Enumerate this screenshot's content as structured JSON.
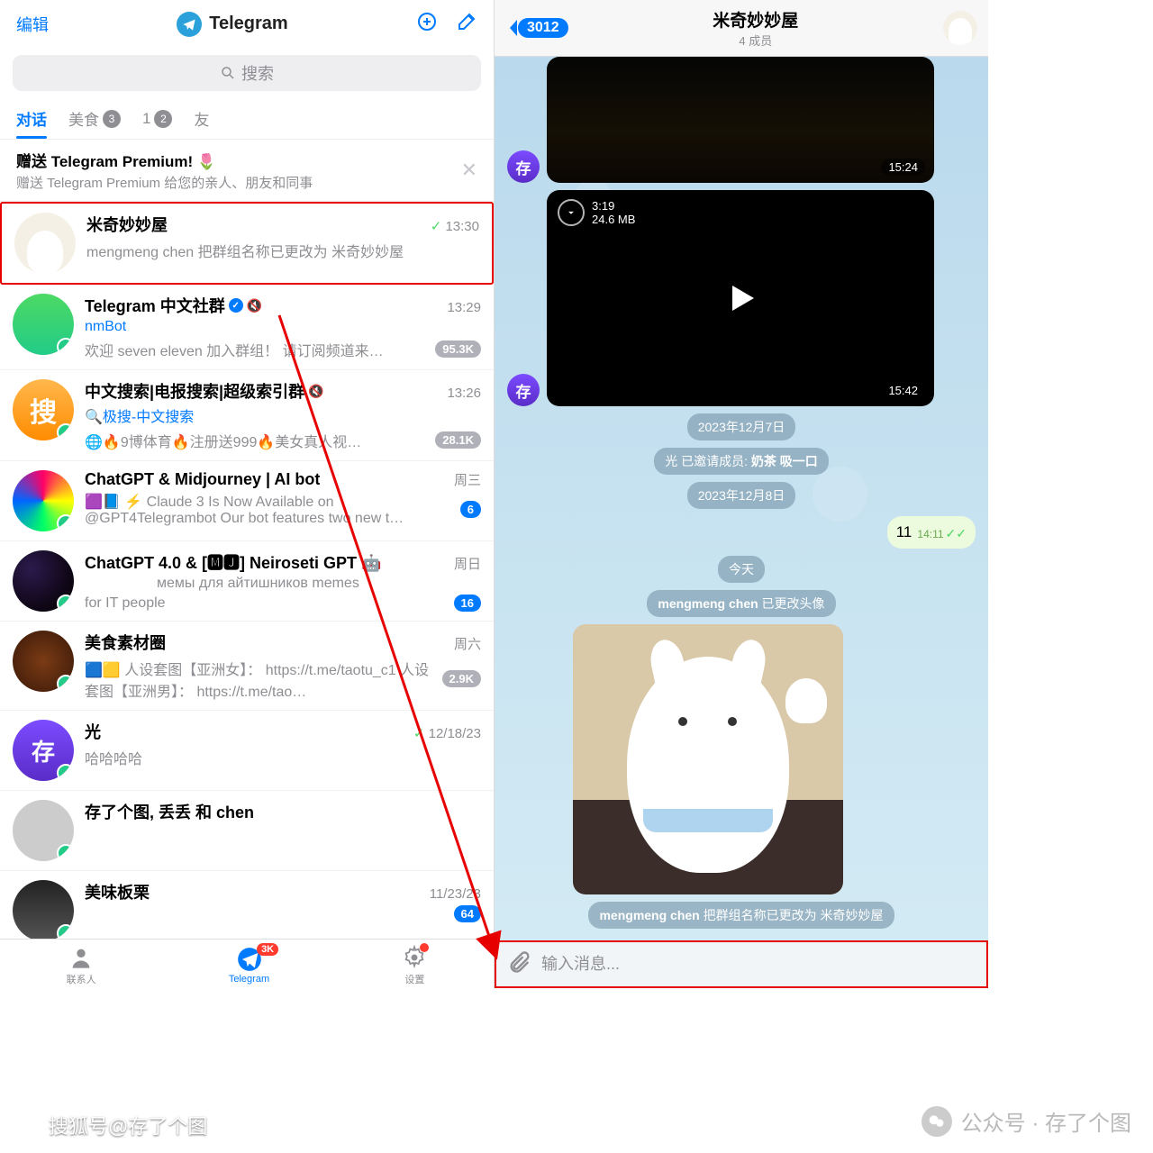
{
  "left": {
    "edit": "编辑",
    "title": "Telegram",
    "search_placeholder": "搜索",
    "tabs": [
      {
        "label": "对话",
        "active": true
      },
      {
        "label": "美食",
        "badge": "3"
      },
      {
        "label": "1",
        "badge": "2"
      },
      {
        "label": "友"
      }
    ],
    "promo": {
      "title": "赠送 Telegram Premium! 🌷",
      "subtitle": "赠送 Telegram Premium 给您的亲人、朋友和同事"
    },
    "chats": [
      {
        "name": "米奇妙妙屋",
        "time": "13:30",
        "check": true,
        "msg": "mengmeng chen 把群组名称已更改为 米奇妙妙屋",
        "sub": "",
        "hl": true,
        "avatar": "cat"
      },
      {
        "name": "Telegram 中文社群",
        "verified": true,
        "muted": true,
        "time": "13:29",
        "sub": "nmBot",
        "msg": "欢迎 seven eleven 加入群组！ 请订阅频道来…",
        "badge": "95.3K",
        "avatar": "green"
      },
      {
        "name": "中文搜索|电报搜索|超级索引群",
        "muted": true,
        "time": "13:26",
        "sub": "🔍极搜-中文搜索",
        "msg": "🌐🔥9博体育🔥注册送999🔥美女真人视…",
        "badge": "28.1K",
        "avatar": "orange",
        "avatarText": "搜"
      },
      {
        "name": "ChatGPT & Midjourney | AI bot",
        "time": "周三",
        "msg": "🟪📘 ⚡ Claude 3 Is Now Available on @GPT4Telegrambot Our bot features two new t…",
        "badge": "6",
        "badgeBlue": true,
        "avatar": "rainbow",
        "ln2": true
      },
      {
        "name": "ChatGPT 4.0 & [🅼🅹] Neiroseti GPT 🤖",
        "time": "周日",
        "msg_pre": "мемы для айтишников memes",
        "msg": "for IT people",
        "badge": "16",
        "badgeBlue": true,
        "avatar": "swirl",
        "ln2": true
      },
      {
        "name": "美食素材圈",
        "time": "周六",
        "msg": "🟦🟨 人设套图【亚洲女】： https://t.me/taotu_c1 人设套图【亚洲男】： https://t.me/tao…",
        "badge": "2.9K",
        "avatar": "food",
        "ln2": true
      },
      {
        "name": "光",
        "time": "12/18/23",
        "check": true,
        "msg": "哈哈哈哈",
        "avatar": "purple",
        "avatarText": "存"
      },
      {
        "name": "存了个图, 丢丢 和 chen",
        "time": "",
        "avatar": "grey"
      },
      {
        "name": "美味板栗",
        "time": "11/23/23",
        "badge": "64",
        "badgeBlue": true,
        "avatar": "chef"
      }
    ],
    "bottombar": {
      "items": [
        {
          "label": "联系人"
        },
        {
          "label": "Telegram",
          "active": true,
          "badge": "3K"
        },
        {
          "label": "设置",
          "dot": true
        }
      ]
    }
  },
  "right": {
    "back_count": "3012",
    "title": "米奇妙妙屋",
    "subtitle": "4 成员",
    "media1_time": "15:24",
    "video": {
      "duration": "3:19",
      "size": "24.6 MB",
      "time": "15:42"
    },
    "date1": "2023年12月7日",
    "sys1_pre": "光 已邀请成员: ",
    "sys1_b": "奶茶 吸一口",
    "date2": "2023年12月8日",
    "out_text": "11",
    "out_time": "14:11",
    "date3": "今天",
    "sys2_b": "mengmeng chen",
    "sys2_post": " 已更改头像",
    "sys3_b": "mengmeng chen",
    "sys3_post": " 把群组名称已更改为 米奇妙妙屋",
    "input_placeholder": "输入消息..."
  },
  "watermark": "公众号 · 存了个图",
  "bl_label": "搜狐号@存了个图"
}
